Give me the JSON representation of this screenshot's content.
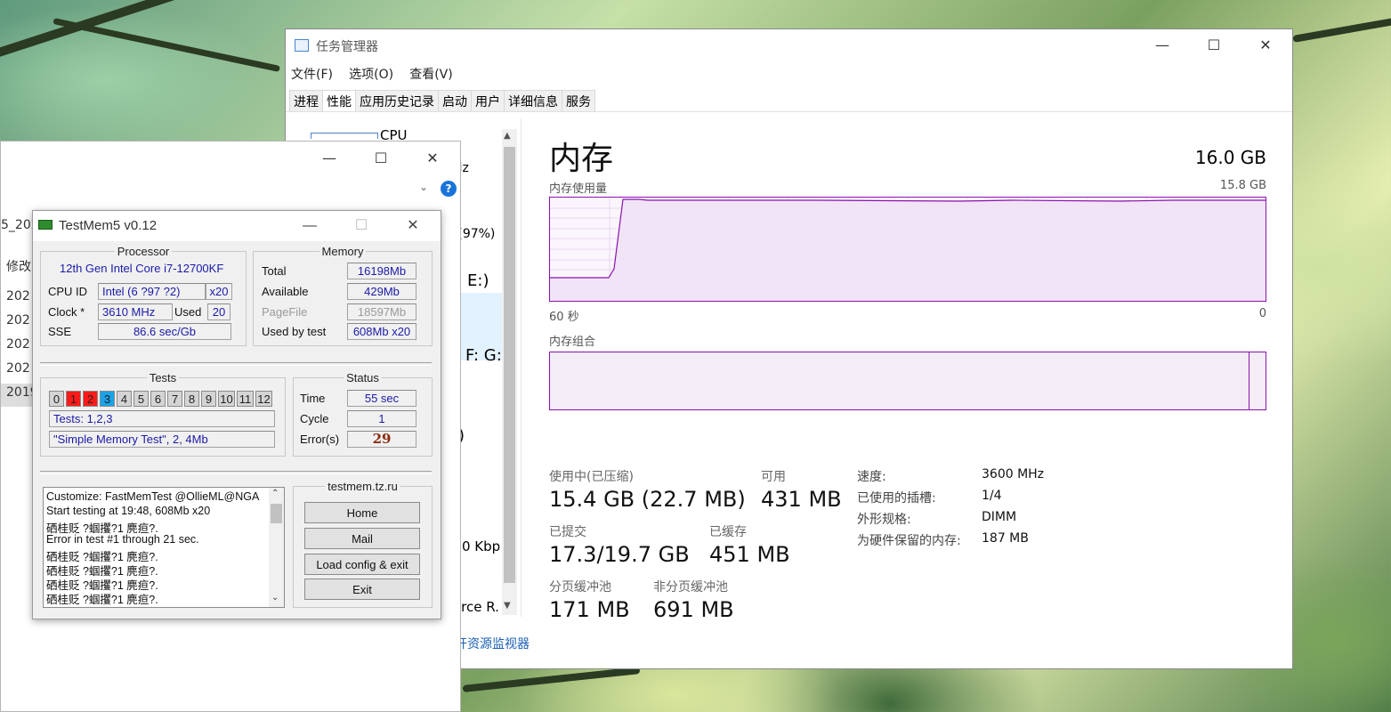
{
  "task_manager": {
    "title": "任务管理器",
    "menu": [
      "文件(F)",
      "选项(O)",
      "查看(V)"
    ],
    "tabs": [
      "进程",
      "性能",
      "应用历史记录",
      "启动",
      "用户",
      "详细信息",
      "服务"
    ],
    "left_panel": {
      "items": [
        "CPU",
        "Hz",
        "3 (97%)",
        "E:)",
        "F: G:",
        ")",
        "0 Kbp",
        "orce R."
      ]
    },
    "resource_monitor_link": "开资源监视器",
    "memory": {
      "title": "内存",
      "total": "16.0 GB",
      "usage_label": "内存使用量",
      "usage_max": "15.8 GB",
      "time_left": "60 秒",
      "time_right": "0",
      "composition_label": "内存组合",
      "usage_fraction": 0.97,
      "stats": {
        "in_use_label": "使用中(已压缩)",
        "in_use_value": "15.4 GB (22.7 MB)",
        "available_label": "可用",
        "available_value": "431 MB",
        "committed_label": "已提交",
        "committed_value": "17.3/19.7 GB",
        "cached_label": "已缓存",
        "cached_value": "451 MB",
        "paged_label": "分页缓冲池",
        "paged_value": "171 MB",
        "nonpaged_label": "非分页缓冲池",
        "nonpaged_value": "691 MB"
      },
      "specs": {
        "speed_label": "速度:",
        "speed_value": "3600 MHz",
        "slots_label": "已使用的插槽:",
        "slots_value": "1/4",
        "form_label": "外形规格:",
        "form_value": "DIMM",
        "reserved_label": "为硬件保留的内存:",
        "reserved_value": "187 MB"
      }
    }
  },
  "background_window": {
    "items": [
      "5_202",
      "修改",
      "202",
      "202",
      "202",
      "202",
      "2019"
    ]
  },
  "testmem": {
    "title": "TestMem5 v0.12",
    "processor": {
      "legend": "Processor",
      "name": "12th Gen Intel Core i7-12700KF",
      "cpu_id_label": "CPU ID",
      "cpu_id_value": "Intel  (6 ?97 ?2)",
      "threads": "x20",
      "clock_label": "Clock *",
      "clock_value": "3610 MHz",
      "used_label": "Used",
      "used_value": "20",
      "sse_label": "SSE",
      "sse_value": "86.6 sec/Gb"
    },
    "memory": {
      "legend": "Memory",
      "total_label": "Total",
      "total_value": "16198Mb",
      "available_label": "Available",
      "available_value": "429Mb",
      "pagefile_label": "PageFile",
      "pagefile_value": "18597Mb",
      "usedbytest_label": "Used by test",
      "usedbytest_value": "608Mb x20"
    },
    "tests": {
      "legend": "Tests",
      "cells": [
        "0",
        "1",
        "2",
        "3",
        "4",
        "5",
        "6",
        "7",
        "8",
        "9",
        "10",
        "11",
        "12"
      ],
      "cell_colors": [
        "#d4d4d4",
        "#ff1a1a",
        "#ff1a1a",
        "#1aa3e8",
        "#d4d4d4",
        "#d4d4d4",
        "#d4d4d4",
        "#d4d4d4",
        "#d4d4d4",
        "#d4d4d4",
        "#d4d4d4",
        "#d4d4d4",
        "#d4d4d4"
      ],
      "selected": "Tests: 1,2,3",
      "current": "\"Simple Memory Test\", 2, 4Mb"
    },
    "status": {
      "legend": "Status",
      "time_label": "Time",
      "time_value": "55 sec",
      "cycle_label": "Cycle",
      "cycle_value": "1",
      "errors_label": "Error(s)",
      "errors_value": "29"
    },
    "log": [
      "Customize: FastMemTest @OllieML@NGA",
      "Start testing at 19:48, 608Mb x20",
      "硒桂贬 ?蝈攫?1 麂疸?.",
      "Error in test #1 through 21 sec.",
      "硒桂贬 ?蝈攫?1 麂疸?.",
      "硒桂贬 ?蝈攫?1 麂疸?.",
      "硒桂贬 ?蝈攫?1 麂疸?.",
      "硒桂贬 ?蝈攫?1 麂疸?."
    ],
    "site": "testmem.tz.ru",
    "buttons": {
      "home": "Home",
      "mail": "Mail",
      "load": "Load config & exit",
      "exit": "Exit"
    }
  }
}
